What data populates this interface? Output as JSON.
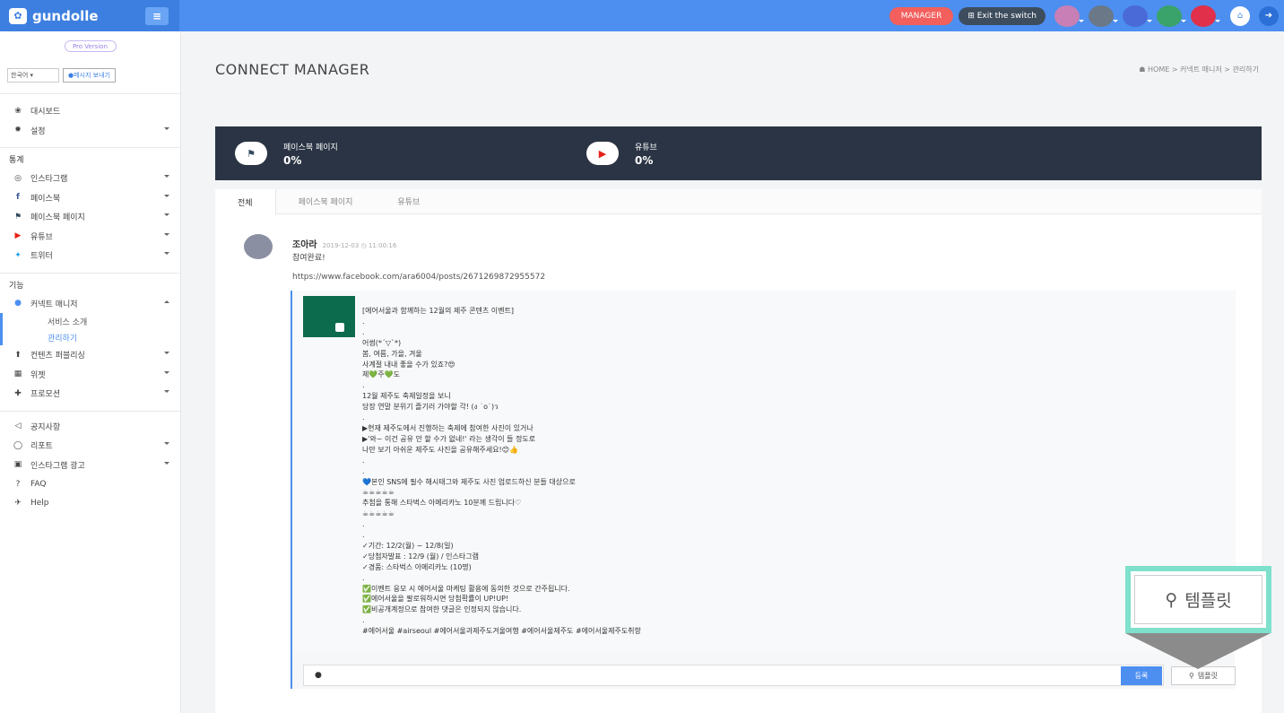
{
  "topbar": {
    "brand": "gundolle",
    "manager_label": "MANAGER",
    "exit_label": "Exit the switch"
  },
  "sidebar": {
    "pro_badge": "Pro Version",
    "language": "한국어",
    "message_btn": "메시지 보내기",
    "items_top": [
      {
        "label": "대시보드",
        "icon": "paw-icon"
      },
      {
        "label": "설정",
        "icon": "gear-icon"
      }
    ],
    "section_stats": "통계",
    "items_stats": [
      {
        "label": "인스타그램",
        "icon": "instagram-icon"
      },
      {
        "label": "페이스북",
        "icon": "facebook-icon"
      },
      {
        "label": "페이스북 페이지",
        "icon": "flag-icon"
      },
      {
        "label": "유튜브",
        "icon": "youtube-icon"
      },
      {
        "label": "트위터",
        "icon": "twitter-icon"
      }
    ],
    "section_features": "기능",
    "connect_manager": "커넥트 매니저",
    "sub_items": [
      {
        "label": "서비스 소개"
      },
      {
        "label": "관리하기"
      }
    ],
    "items_features": [
      {
        "label": "컨텐츠 퍼블리싱",
        "icon": "upload-icon"
      },
      {
        "label": "위젯",
        "icon": "grid-icon"
      },
      {
        "label": "프로모션",
        "icon": "gift-icon"
      }
    ],
    "items_bottom": [
      {
        "label": "공지사항",
        "icon": "megaphone-icon"
      },
      {
        "label": "리포트",
        "icon": "report-icon"
      },
      {
        "label": "인스타그램 광고",
        "icon": "ad-icon"
      },
      {
        "label": "FAQ",
        "icon": "question-icon"
      },
      {
        "label": "Help",
        "icon": "paper-plane-icon"
      }
    ]
  },
  "page": {
    "title": "CONNECT MANAGER",
    "breadcrumb": "HOME  >  커넥트 매니저  >  관리하기"
  },
  "stats": [
    {
      "label": "페이스북 페이지",
      "value": "0%",
      "icon": "flag-icon"
    },
    {
      "label": "유튜브",
      "value": "0%",
      "icon": "youtube-icon"
    }
  ],
  "tabs": [
    "전체",
    "페이스북 페이지",
    "유튜브"
  ],
  "comment": {
    "author": "조아라",
    "date": "2019-12-03 ◷ 11:00:16",
    "body": "참여완료!",
    "link": "https://www.facebook.com/ara6004/posts/2671269872955572"
  },
  "post": {
    "text": "[에어서울과 함께하는 12월의 제주 콘텐츠 이벤트]\n.\n.\n어썸(*ˊ▽ˋ*)\n봄, 여름, 가을, 겨울\n사계절 내내 좋을 수가 있죠?😍\n제💚주💚도\n.\n12월 제주도 축제일정을 보니\n당장 연말 분위기 즐기러 가야할 각! (ง ˙o˙)ว\n.\n▶현재 제주도에서 진행하는 축제에 참여한 사진이 있거나\n▶'와~ 이건 공유 안 할 수가 없네!' 라는 생각이 들 정도로\n나만 보기 아쉬운 제주도 사진을 공유해주세요!😊👍\n.\n.\n💙본인 SNS에 필수 해시태그와 제주도 사진 업로드하신 분들 대상으로\n☕☕☕☕☕\n추첨을 통해 스타벅스 아메리카노 10분께 드립니다♡\n☕☕☕☕☕\n.\n.\n✓기간: 12/2(월) ~ 12/8(일)\n✓당첨자발표 : 12/9 (월) / 인스타그램\n✓경품: 스타벅스 아메리카노 (10명)\n.\n✅이벤트 응모 시 에어서울 마케팅 활용에 동의한 것으로 간주됩니다.\n✅에어서울을 팔로워하시면 당첨확률이 UP!UP!\n✅비공개계정으로 참여한 댓글은 인정되지 않습니다.\n.\n#에어서울 #airseoul #에어서울과제주도겨울여행 #에어서울제주도 #에어서울제주도취항"
  },
  "reply": {
    "placeholder": "",
    "submit_label": "등록",
    "template_label": "템플릿"
  },
  "callout": {
    "label": "템플릿"
  },
  "colors": {
    "topbar": "#4c8ff0",
    "manager": "#f25f5c",
    "stats_bg": "#2a3444",
    "callout_border": "#7fe0cc"
  }
}
